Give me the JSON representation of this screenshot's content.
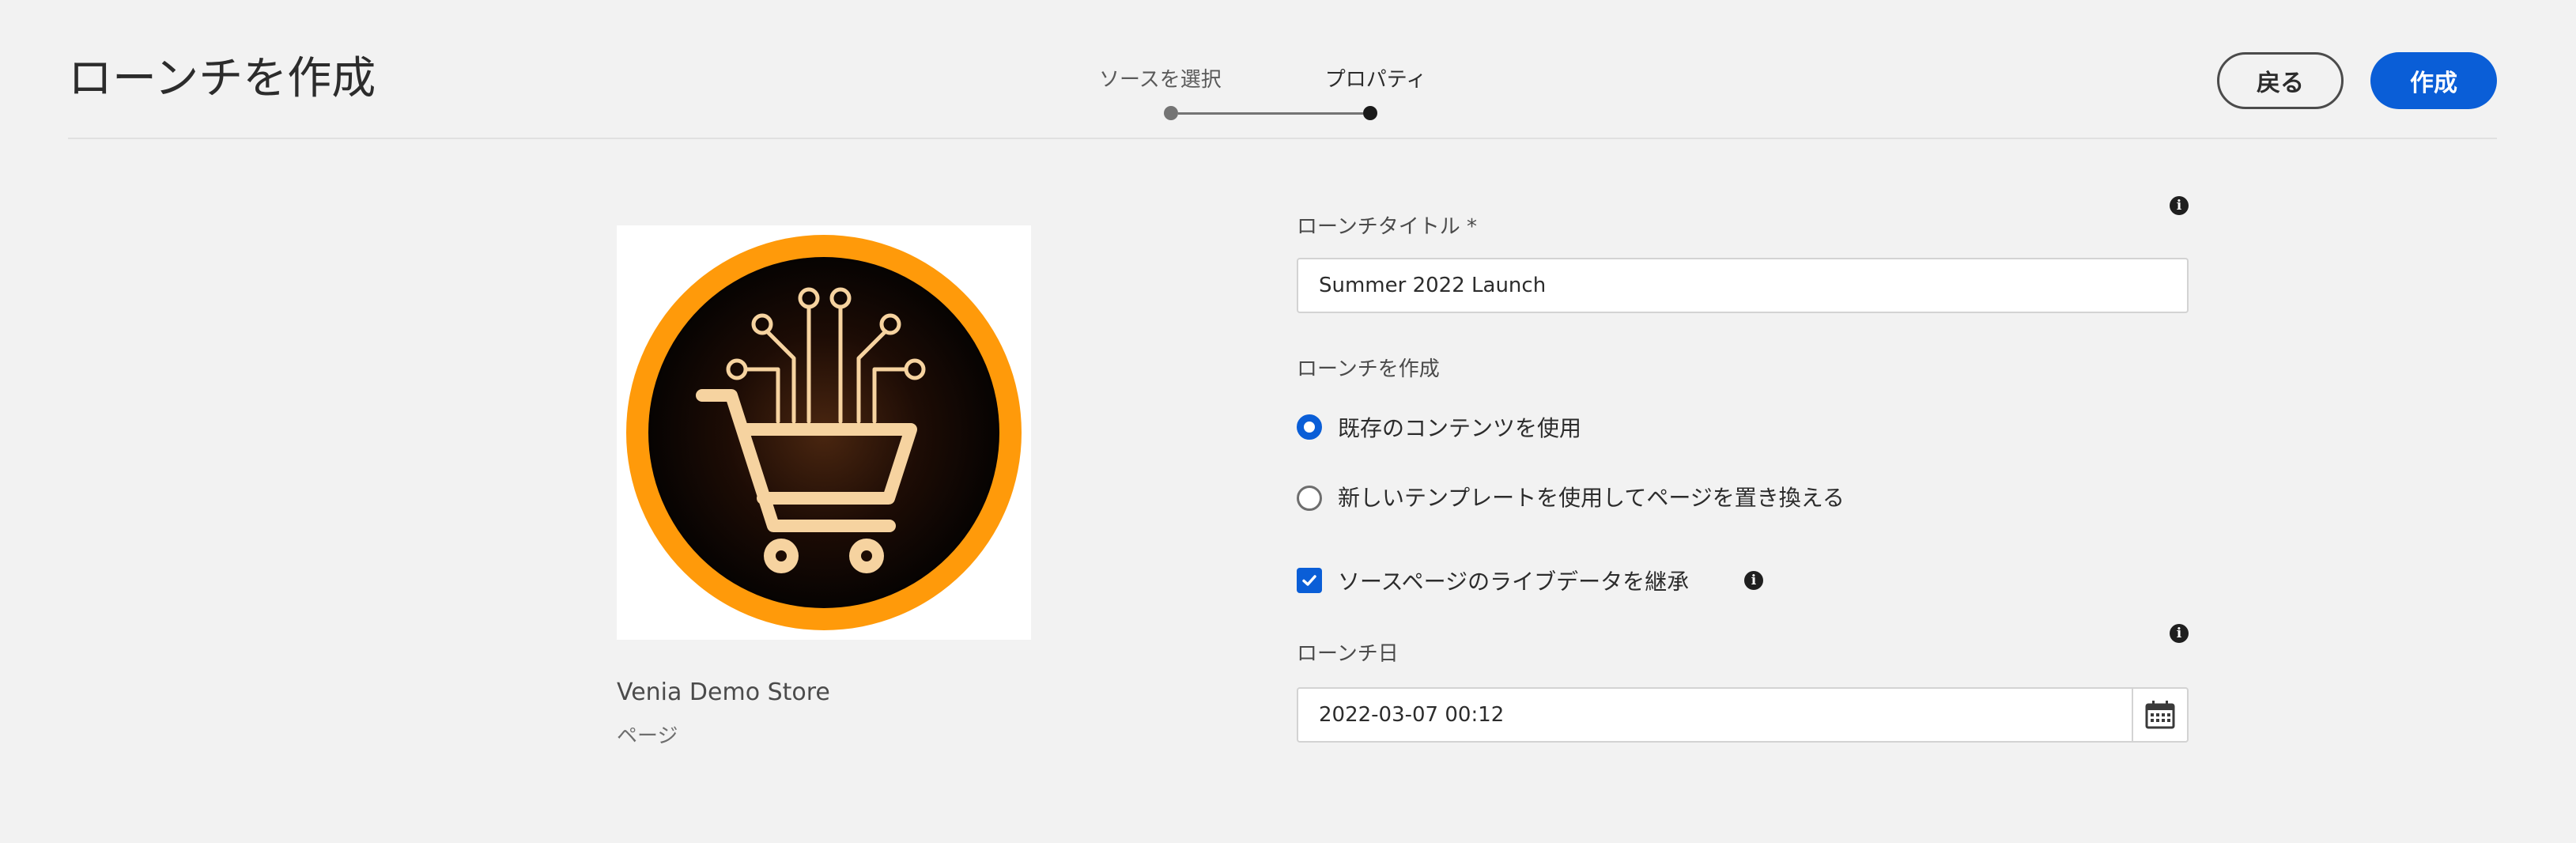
{
  "header": {
    "title": "ローンチを作成",
    "steps": [
      {
        "label": "ソースを選択",
        "state": "completed"
      },
      {
        "label": "プロパティ",
        "state": "current"
      }
    ],
    "back_label": "戻る",
    "create_label": "作成"
  },
  "source": {
    "name": "Venia Demo Store",
    "type": "ページ"
  },
  "form": {
    "launch_title_label": "ローンチタイトル *",
    "launch_title_value": "Summer 2022 Launch",
    "create_launch_label": "ローンチを作成",
    "options": [
      {
        "label": "既存のコンテンツを使用",
        "selected": true
      },
      {
        "label": "新しいテンプレートを使用してページを置き換える",
        "selected": false
      }
    ],
    "inherit_live_data_label": "ソースページのライブデータを継承",
    "inherit_live_data_checked": true,
    "launch_date_label": "ローンチ日",
    "launch_date_value": "2022-03-07 00:12"
  },
  "icons": {
    "info": "info-icon",
    "calendar": "calendar-icon",
    "checkmark": "checkmark-icon",
    "thumbnail": "shopping-cart-logo"
  },
  "colors": {
    "accent": "#0a5ed7",
    "background": "#f2f2f2",
    "logo_ring": "#ff9a0a",
    "logo_cart": "#f6d3a0"
  }
}
